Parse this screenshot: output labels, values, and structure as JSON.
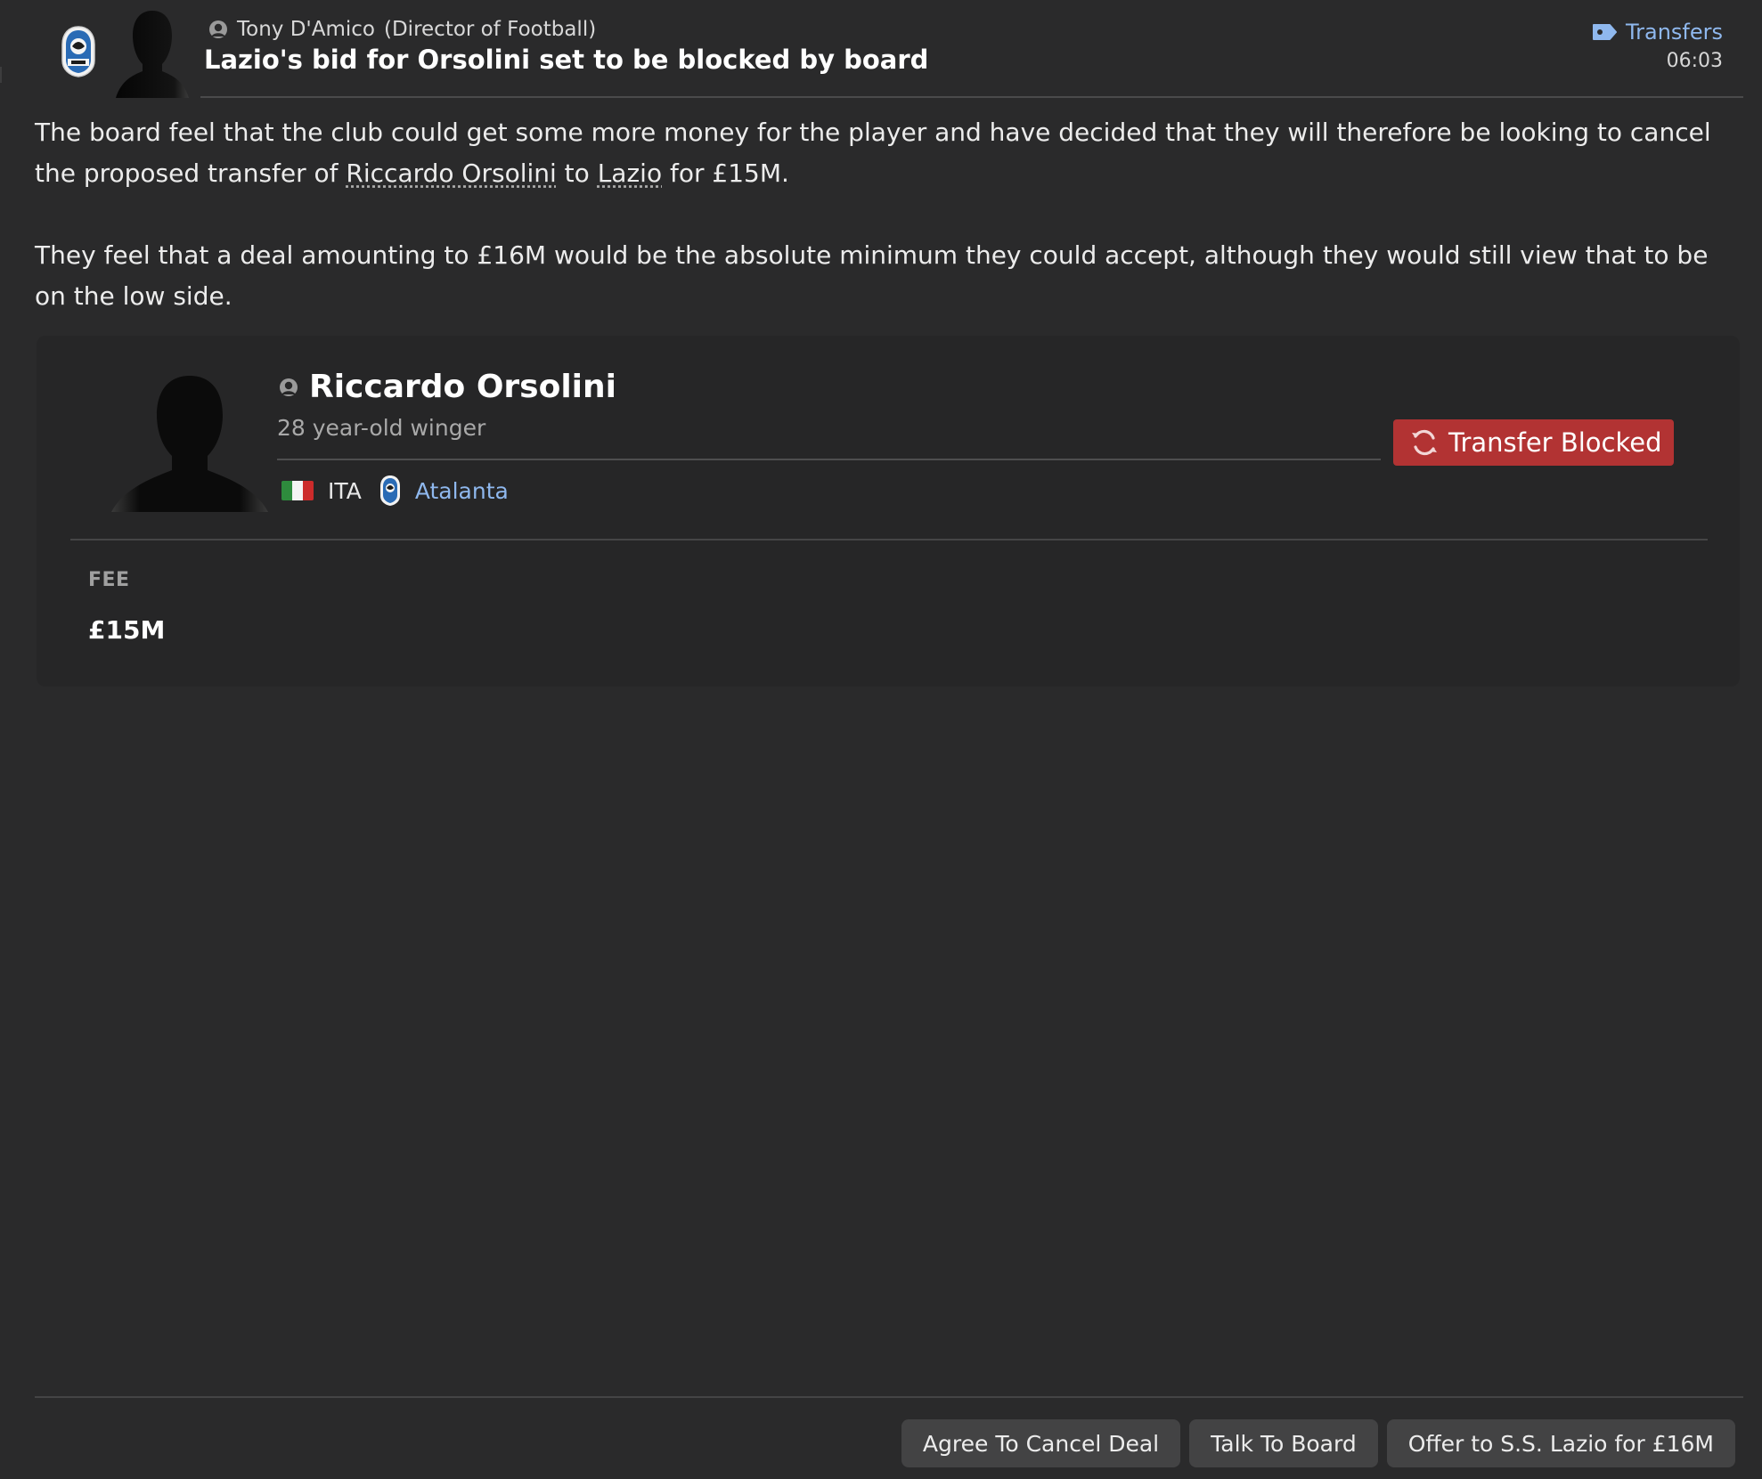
{
  "header": {
    "sender_name": "Tony D'Amico",
    "sender_role": "(Director of Football)",
    "headline": "Lazio's bid for Orsolini set to be blocked by board",
    "category": "Transfers",
    "time": "06:03",
    "icons": {
      "crest": "club-crest-icon",
      "sender": "person-silhouette-icon",
      "category": "tag-icon"
    }
  },
  "body": {
    "p1_before": "The board feel that the club could get some more money for the player and have decided that they will therefore be looking to cancel the proposed transfer of ",
    "p1_player": "Riccardo Orsolini",
    "p1_mid": " to ",
    "p1_club": "Lazio",
    "p1_after": " for £15M.",
    "p2": "They feel that a deal amounting to £16M would be the absolute minimum they could accept, although they would still view that to be on the low side."
  },
  "player_card": {
    "name": "Riccardo Orsolini",
    "description": "28 year-old winger",
    "nation_code": "ITA",
    "club": "Atalanta",
    "status": "Transfer Blocked",
    "fee_label": "FEE",
    "fee_value": "£15M",
    "colors": {
      "status_bg": "#b23333",
      "link": "#8fb8ee"
    }
  },
  "footer": {
    "buttons": [
      "Agree To Cancel Deal",
      "Talk To Board",
      "Offer to S.S. Lazio for £16M"
    ]
  }
}
